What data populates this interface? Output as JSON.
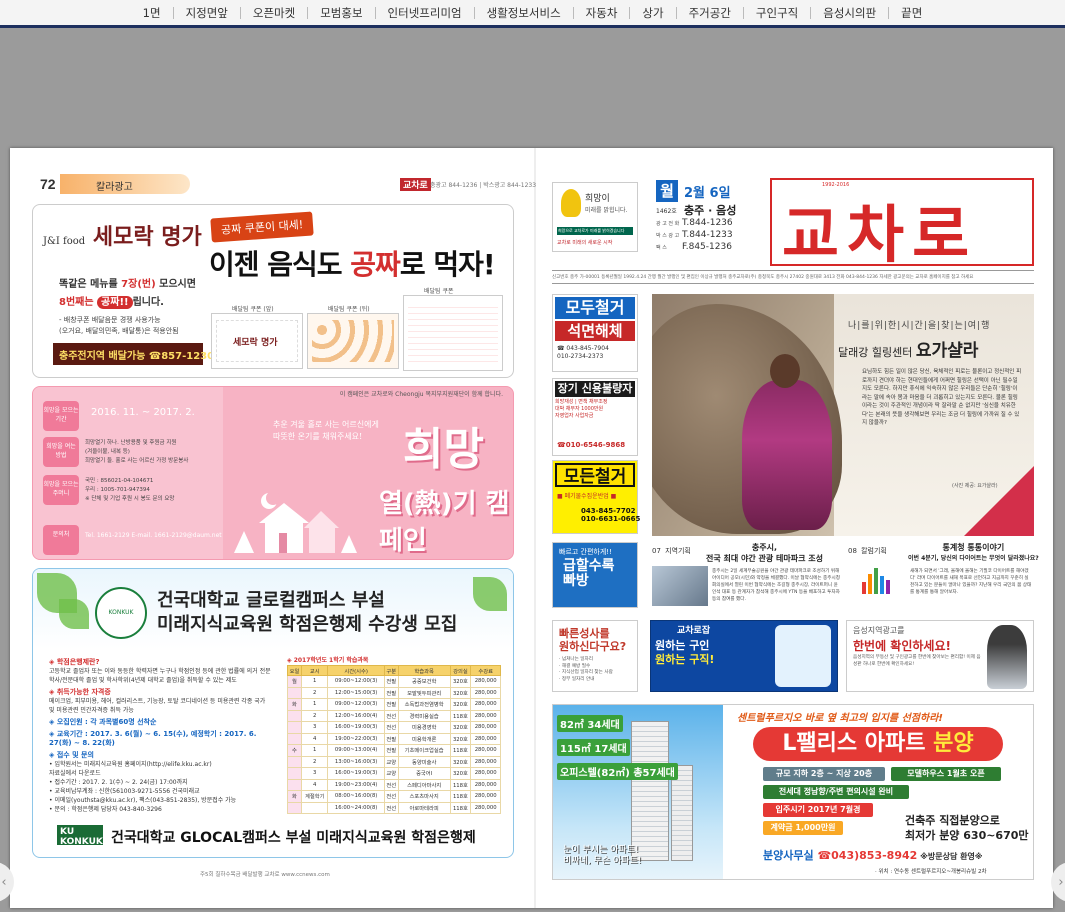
{
  "nav": {
    "items": [
      "1면",
      "지정면앞",
      "오픈마켓",
      "모범홍보",
      "인터넷프리미엄",
      "생활정보서비스",
      "자동차",
      "상가",
      "주거공간",
      "구인구직",
      "음성시의판",
      "끝면"
    ]
  },
  "left_page": {
    "page_number": "72",
    "section": "칼라광고",
    "paper_logo": "교차로",
    "contact": "충광고 844-1236 | 박스광고 844-1233",
    "ad1": {
      "brand": "세모락 명가",
      "brand_small": "J&I food",
      "ribbon": "공짜 쿠폰이 대세!",
      "headline_pre": "이젠 음식도 ",
      "headline_red": "공짜",
      "headline_post": "로 먹자!",
      "line1_pre": "똑같은 메뉴를 ",
      "line1_red": "7장(번)",
      "line1_post": " 모으시면",
      "line2_pre": "8번째는 ",
      "line2_badge": "공짜!!",
      "line2_post": "립니다.",
      "bullet1": "- 배창쿠폰 배달음문 경쟁 사용가능",
      "bullet2": "(오거요, 배달의민족, 배달통)은 적용안됨",
      "phone": "충주전지역 배달가능 ☎857-1230",
      "coupon1_cap": "배달팀 쿠폰 (앞)",
      "coupon2_cap": "배달팀 쿠폰 (뒤)",
      "coupon3_cap": "배달팀 쿠폰"
    },
    "ad2": {
      "note": "이 캠페인은 교차로와 Cheongju 복지부지원재단이 함께 합니다.",
      "date": "2016. 11. ~ 2017. 2.",
      "row1_label": "희망을 모으는 기간",
      "row2_label": "희망을 여는 방법",
      "row2_text1": "희망열기 하나.  난방용품 및 후원금 지원",
      "row2_text2": "(겨울이불, 내복 등)",
      "row2_text3": "희망열기 둘.    홀로 사는 어르신 가정 방문봉사",
      "row3_label": "희망을 모으는 주머니",
      "row3_text1": "국민 : 856021-04-104671",
      "row3_text2": "우리 : 1005-701-947394",
      "row3_text3": "※ 단체 및 기업 후원 시 봉도 문의 요망",
      "row4_label": "문의처",
      "row4_text": "Tel. 1661-2129  E-mail. 1661-2129@daum.net",
      "quote1": "추운 겨울 홀로 사는 어르신에게",
      "quote2": "따뜻한 온기를 채워주세요!",
      "title1": "희망",
      "title2": "열(熱)기 캠페인"
    },
    "ad3": {
      "title_line1": "건국대학교 글로컬캠퍼스 부설",
      "title_line2": "미래지식교육원 학점은행제 수강생 모집",
      "seal": "KONKUK",
      "h1": "◈ 학점은행제란?",
      "p1": "고등학교 졸업자 또는 이와 동등한 학력자면 누구나 학점인정 등에 관한 법률에 의거 전문 학사/전문대학 졸업 및 학사학위(4년제 대학교 졸업)을 취득할 수 있는 제도",
      "h2": "◈ 취득가능한 자격증",
      "p2": "메이크업, 피부미용, 헤어, 컬러리스트, 기능장, 토탈 코디네이션 등 미용관련 각종 국가 및 미용관련 민간자격증 취득 가능",
      "h3": "◈ 오집인원 : 각 과목별60명 선착순",
      "h4": "◈ 교육기간 : 2017. 3. 6(월) ~ 6. 15(수), 예정학기 : 2017. 6. 27(화) ~ 8. 22(화)",
      "h5": "◈ 접수 및 문의",
      "p5a": "• 입학원서는 미래지식교육원 홈페이지(http://elife.kku.ac.kr)",
      "p5b": "  자료실에서 다운로드",
      "p5c": "• 접수기간 : 2017. 2. 1(수) ~ 2. 24(금) 17:00까지",
      "p5d": "• 교육비납부계좌 : 신한(561003-9271-5556 건국미래교",
      "p5e": "• 이메일(youthsta@kku.ac.kr), 팩스(043-851-2835), 방문접수 가능",
      "p5f": "• 문의 : 학점은행제 담당자 043-840-3296",
      "table_caption": "◈ 2017학년도 1학기 학습과목",
      "table_headers": [
        "요일",
        "교시",
        "시간(시수)",
        "구분",
        "학습과목",
        "강의실",
        "수강료"
      ],
      "table_rows": [
        [
          "월",
          "1",
          "09:00~12:00(3)",
          "전필",
          "공중보건학",
          "320호",
          "280,000"
        ],
        [
          "",
          "2",
          "12:00~15:00(3)",
          "전필",
          "모발및두피관리",
          "320호",
          "280,000"
        ],
        [
          "화",
          "1",
          "09:00~12:00(3)",
          "전필",
          "소독법과전염병학",
          "320호",
          "280,000"
        ],
        [
          "",
          "2",
          "12:00~16:00(4)",
          "전선",
          "경력미용실습",
          "118호",
          "280,000"
        ],
        [
          "",
          "3",
          "16:00~19:00(3)",
          "전선",
          "미용경영학",
          "320호",
          "280,000"
        ],
        [
          "",
          "4",
          "19:00~22:00(3)",
          "전필",
          "미용학개론",
          "320호",
          "280,000"
        ],
        [
          "수",
          "1",
          "09:00~13:00(4)",
          "전필",
          "기초메이크업실습",
          "118호",
          "280,000"
        ],
        [
          "",
          "2",
          "13:00~16:00(3)",
          "교양",
          "동양미술사",
          "320호",
          "280,000"
        ],
        [
          "",
          "3",
          "16:00~19:00(3)",
          "교양",
          "중국어Ⅰ",
          "320호",
          "280,000"
        ],
        [
          "",
          "4",
          "19:00~23:00(4)",
          "전선",
          "스페디아마사지",
          "118호",
          "280,000"
        ],
        [
          "화",
          "계절학기",
          "08:00~16:00(8)",
          "전선",
          "스포츠마사지",
          "118호",
          "280,000"
        ],
        [
          "",
          "",
          "16:00~24:00(8)",
          "전선",
          "아로마테라피",
          "118호",
          "280,000"
        ]
      ],
      "ku_badge": "KU KONKUK",
      "footer_text": "건국대학교 GLOCAL캠퍼스 부설 미래지식교육원 학점은행제"
    },
    "foot": "주5회 칠하수목금 배달발행   교차로 www.ccnews.com"
  },
  "right_page": {
    "logo_box": {
      "title": "희망이",
      "subtitle": "미래를 밝힙니다.",
      "strip": "희망으로 교차로가 미래를 밝히겠습니다",
      "tiny": "교차로 미래의 새로운 시작"
    },
    "issue": {
      "day_badge": "월",
      "date": "2월 6일",
      "issue_no": "1462호",
      "region": "충주 · 음성",
      "tel_label1": "광 고 전 화",
      "tel1": "T.844-1236",
      "tel_label2": "박 스 광 고",
      "tel2": "T.844-1233",
      "tel_label3": "팩 스",
      "tel3": "F.845-1236"
    },
    "masthead": {
      "since": "1992-2016",
      "name": "교차로"
    },
    "credits": "신고번호 충주 가-00001  등록년월일 1992.4.24  간행 월간  발행인 및 편집인 이상규  발행처 충주교차로(주)  충청북도 충주시 27402 중원대로 3413  전화 043-844-1236  자세한 광고문의는 교차로 홈페이지를 참고 하세요",
    "side1": {
      "t1": "모두철거",
      "t2": "석면해체",
      "t3a": "☎ 043-845-7904",
      "t3b": "010-2734-2373"
    },
    "side2": {
      "t1": "장기 신용불량자",
      "t2a": "희망재성 | 면책 채무조정",
      "t2b": "대박 채무자 1000만원",
      "t2c": "자영업자 사업자금",
      "t3": "☎010-6546-9868"
    },
    "side3": {
      "t1": "모든철거",
      "t2": "■ 폐기물수집운반업 ■",
      "t3a": "043-845-7702",
      "t3b": "010-6631-0665"
    },
    "feature": {
      "kicker": "나|를|위|한|시|간|을|찾|는|여|행",
      "title_sub": "달래강 힐링센터 ",
      "title": "요가샬라",
      "body": "요님하도 힘든 일이 많은 당신, 육체적인 피로는 물론이고 정신적인 피로까지 견뎌야 하는 현대인들에게 어쩌면 힐링은 선택이 아닌 필수일지도 모른다. 하지만 휴식에 익숙하지 않은 우리들은 단순히 '힐링'이라는 말에 속아 몸과 마음을 더 괴롭히고 있는지도 모른다. 물론 힐링이라는 것이 주관적인 개념이라 딱 잘라말 순 없지만 '심신을 치유한다'는 본래의 뜻을 생각해보면 우리는 조금 더 힐링에 가까워 질 수 있지 않을까?",
      "caption": "(사진 제공: 요가샬라)"
    },
    "side4": {
      "t1": "빠르고 간편하게!!",
      "t2a": "급할수록",
      "t2b": "빠방"
    },
    "news1": {
      "num": "07",
      "sect": "지역기획",
      "headline1": "충주시,",
      "headline2": "전국 최대 야간 관광 테마파크 조성",
      "body": "충주시는 2일 세계무술공원을 야간 관광 테마파크로 조성하기 위해 아이디어 공모(시민)와 약정을 체결했다. 이날 협약식에는 충주시청 회의실에서 열린 이번 협약식에는 조길형 충주시장, 라이트퍼니 윤인석 대표 등 관계자가 참석해 충주시에 YTN 등을 배포하고 투자자 등의 참여를 했다."
    },
    "news2": {
      "num": "08",
      "sect": "칼럼기획",
      "headline1": "통계청 통통이야기",
      "headline2": "이번 4분기, 당신의 다이어트는 무엇이 달라졌나요?",
      "body": "새해가 되면서 '그래, 올해에 올해는 기필코 다이어트를 해야겠다' 라며 다이어트를 새해 목표로 선언하고 지금까지 꾸준히 실천하고 있는 분들이 얼마나 있을까? 지난해 우리 국민의 몸 상태를 통계를 통해 알아보자."
    },
    "side5": {
      "t1a": "빠른성사를",
      "t1b": "원하신다구요?",
      "t2a": "· 넘쳐나는 일자리",
      "t2b": "· 해결 예방 필수",
      "t2c": "· 지식산업 일자리 찾는 사람",
      "t2d": "· 정부 일자리 안내"
    },
    "mid_ad": {
      "brand": "교차로잡",
      "big1": "원하는 구인",
      "big2": "원하는 구직!"
    },
    "right_ad": {
      "t1": "음성지역광고를",
      "t2": "한번에 확인하세요!",
      "t3": "음성지역의 부동산 및 구인광고를 한번에 찾아보는 편리함! 이제 음성판 하나로 한번에 확인하세요!"
    },
    "apt": {
      "tag1": "82㎡ 34세대",
      "tag2": "115㎡ 17세대",
      "tag3": "오피스텔(82㎡) 총57세대",
      "slogan1": "눈이 부시는 아파트!",
      "slogan2": "비싸네, 무슨 아파트!",
      "head": "센트럴푸르지오 바로 옆 최고의 입지를 선점하라!",
      "title_pre": "L팰리스 아파트 ",
      "title_hi": "분양",
      "pill1": "규모 지하 2층 ~ 지상 20층",
      "pill2": "모델하우스 1월초 오픈",
      "pill3": "전세대 정남향/주변 편의시설 완비",
      "pill4": "입주시기 2017년 7월경",
      "pill5": "계약금 1,000만원",
      "price1": "건축주 직접분양으로",
      "price2": "최저가 분양 630~670만",
      "office_label": "분양사무실",
      "office_phone": "☎043)853-8942",
      "office_sm": " ※방문상담 환영※",
      "addr": "· 위치 : 연수동 센트럴푸르지오~개봉리슈빌 2차"
    }
  },
  "colors": {
    "nav_border": "#1d2f5e",
    "brand_red": "#d62828",
    "pink": "#f7b3c4",
    "blue": "#1565c0"
  }
}
